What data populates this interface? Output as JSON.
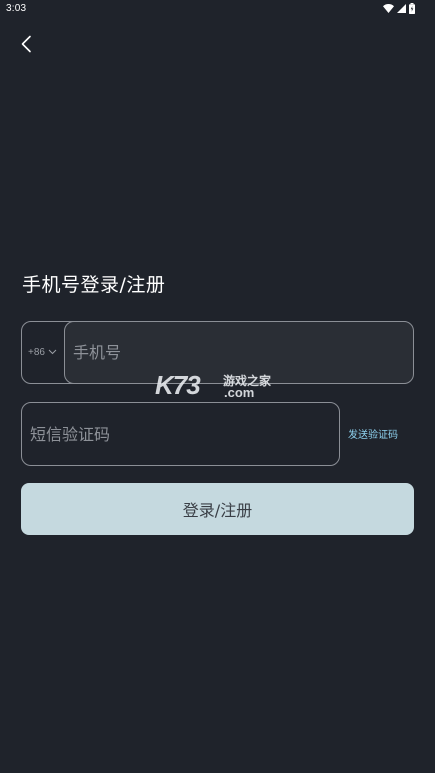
{
  "status_bar": {
    "time": "3:03",
    "icons": [
      "wifi-icon",
      "signal-icon",
      "battery-icon"
    ]
  },
  "header": {
    "back_icon": "chevron-left-icon"
  },
  "page": {
    "title": "手机号登录/注册"
  },
  "form": {
    "country_code": "+86",
    "phone_placeholder": "手机号",
    "phone_value": "",
    "code_placeholder": "短信验证码",
    "code_value": "",
    "send_code_label": "发送验证码",
    "submit_label": "登录/注册"
  },
  "watermark": {
    "brand": "K73",
    "name": "游戏之家",
    "domain": ".com"
  },
  "colors": {
    "background": "#1f232b",
    "accent_link": "#8fd3f0",
    "button_bg": "#c5d9df",
    "button_text": "#3a3f46",
    "border": "#8b8f96"
  }
}
